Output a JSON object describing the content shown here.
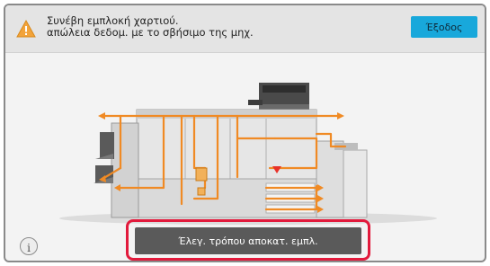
{
  "header": {
    "message_line1": "Συνέβη εμπλοκή χαρτιού.",
    "message_line2": "απώλεια δεδομ. με το σβήσιμο της μηχ.",
    "exit_label": "Έξοδος",
    "warning_icon": "warning-triangle-icon"
  },
  "footer": {
    "guide_button_label": "Έλεγ. τρόπου αποκατ. εμπλ.",
    "info_icon_glyph": "i",
    "info_icon": "info-icon"
  },
  "colors": {
    "accent": "#18a8db",
    "paper_path": "#f08a24",
    "highlight": "#e21a3c",
    "jam_marker": "#e8322a"
  }
}
